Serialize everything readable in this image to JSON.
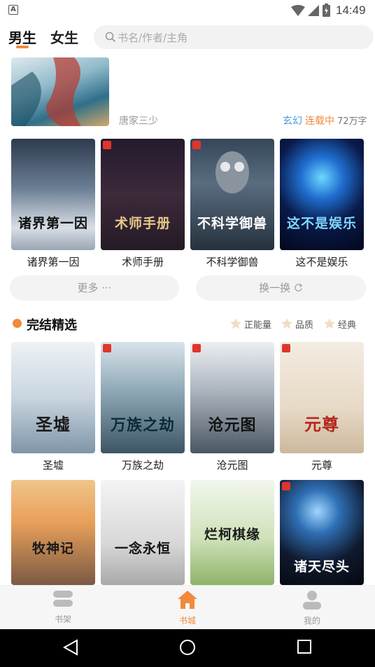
{
  "status_bar": {
    "time": "14:49",
    "indicator": "A"
  },
  "header": {
    "tabs": [
      {
        "label": "男生"
      },
      {
        "label": "女生"
      }
    ],
    "search_placeholder": "书名/作者/主角"
  },
  "featured": {
    "author": "唐家三少",
    "genre": "玄幻",
    "status": "连载中",
    "words": "72万字"
  },
  "recommend": {
    "books": [
      {
        "name": "诸界第一因",
        "cover_text": "诸界第一因"
      },
      {
        "name": "术师手册",
        "cover_text": "术师手册"
      },
      {
        "name": "不科学御兽",
        "cover_text": "不科学御兽"
      },
      {
        "name": "这不是娱乐",
        "cover_text": "这不是娱乐"
      }
    ],
    "more_label": "更多 ···",
    "refresh_label": "换一换"
  },
  "completed": {
    "title": "完结精选",
    "filters": [
      "正能量",
      "品质",
      "经典"
    ],
    "books_row1": [
      {
        "name": "圣墟",
        "cover_text": "圣墟"
      },
      {
        "name": "万族之劫",
        "cover_text": "万族之劫"
      },
      {
        "name": "沧元图",
        "cover_text": "沧元图"
      },
      {
        "name": "元尊",
        "cover_text": "元尊"
      }
    ],
    "books_row2": [
      {
        "cover_text": "牧神记"
      },
      {
        "cover_text": "一念永恒"
      },
      {
        "cover_text": "烂柯棋缘"
      },
      {
        "cover_text": "诸天尽头"
      }
    ]
  },
  "bottom_nav": [
    {
      "label": "书架"
    },
    {
      "label": "书城"
    },
    {
      "label": "我的"
    }
  ],
  "colors": {
    "accent": "#f08a3c",
    "genre": "#4a9be0"
  }
}
